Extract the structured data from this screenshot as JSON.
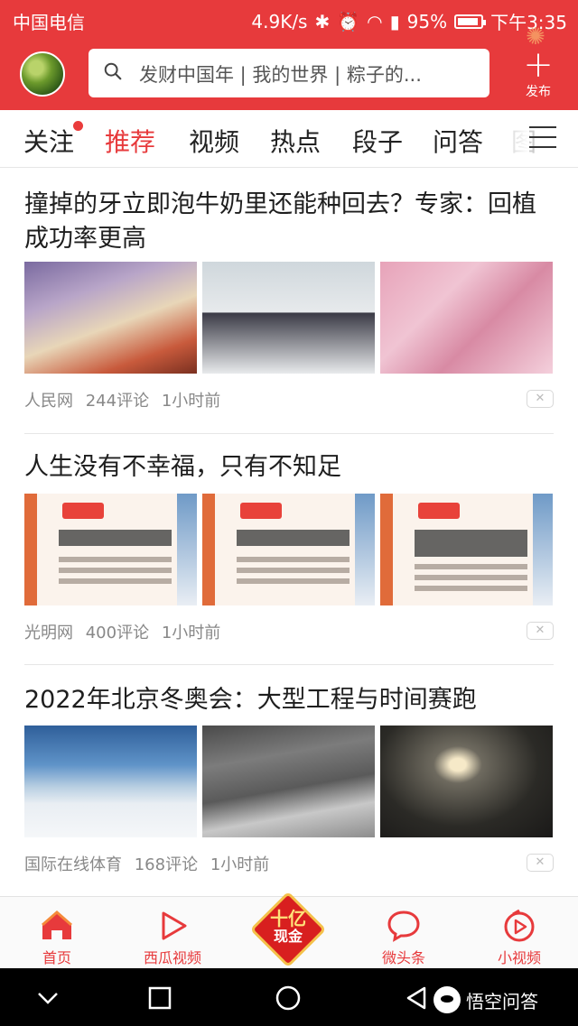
{
  "status_bar": {
    "carrier": "中国电信",
    "speed": "4.9K/s",
    "battery": "95%",
    "time": "下午3:35"
  },
  "header": {
    "search_placeholder": "发财中国年 | 我的世界 | 粽子的...",
    "publish_label": "发布",
    "accent_color": "#e73a3c"
  },
  "tabs": [
    {
      "label": "关注",
      "has_dot": true
    },
    {
      "label": "推荐",
      "active": true
    },
    {
      "label": "视频"
    },
    {
      "label": "热点"
    },
    {
      "label": "段子"
    },
    {
      "label": "问答"
    },
    {
      "label": "图"
    }
  ],
  "feed": [
    {
      "title": "撞掉的牙立即泡牛奶里还能种回去？专家：回植成功率更高",
      "source": "人民网",
      "comments": "244评论",
      "time": "1小时前"
    },
    {
      "title": "人生没有不幸福，只有不知足",
      "source": "光明网",
      "comments": "400评论",
      "time": "1小时前"
    },
    {
      "title": "2022年北京冬奥会：大型工程与时间赛跑",
      "source": "国际在线体育",
      "comments": "168评论",
      "time": "1小时前"
    }
  ],
  "bottom_nav": {
    "home": "首页",
    "xigua": "西瓜视频",
    "center_top": "十亿",
    "center_bottom": "现金",
    "weitoutiao": "微头条",
    "small_video": "小视频"
  },
  "watermark": "悟空问答"
}
